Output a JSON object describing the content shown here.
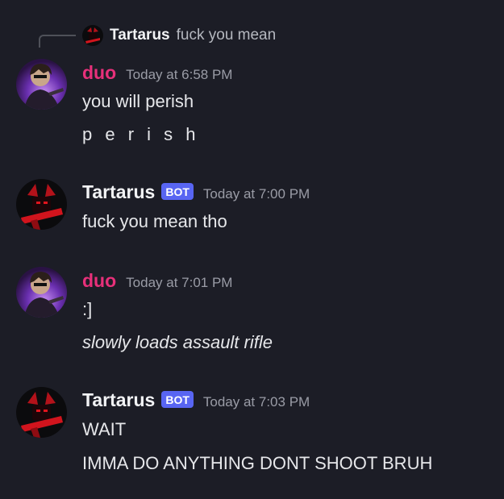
{
  "reply": {
    "author": "Tartarus",
    "text": "fuck you mean"
  },
  "messages": [
    {
      "author": "duo",
      "timestamp": "Today at 6:58 PM",
      "lines": [
        "you will perish",
        "p e r i s h"
      ]
    },
    {
      "author": "Tartarus",
      "badge": "BOT",
      "timestamp": "Today at 7:00 PM",
      "lines": [
        "fuck you mean tho"
      ]
    },
    {
      "author": "duo",
      "timestamp": "Today at 7:01 PM",
      "lines": [
        ":]",
        "slowly loads assault rifle"
      ]
    },
    {
      "author": "Tartarus",
      "badge": "BOT",
      "timestamp": "Today at 7:03 PM",
      "lines": [
        "WAIT",
        "IMMA DO ANYTHING DONT SHOOT BRUH"
      ]
    }
  ],
  "colors": {
    "background": "#1c1d26",
    "duo_name": "#e8307a",
    "bot_badge": "#5865f2",
    "timestamp": "#9a9ca6"
  }
}
